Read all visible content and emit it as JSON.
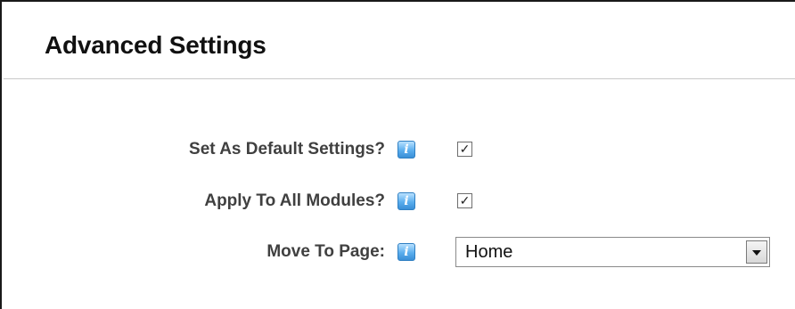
{
  "section": {
    "title": "Advanced Settings"
  },
  "settings": [
    {
      "label": "Set As Default Settings?",
      "help_icon": "help-icon",
      "checked": true,
      "check_mark": "✓"
    },
    {
      "label": "Apply To All Modules?",
      "help_icon": "help-icon",
      "checked": true,
      "check_mark": "✓"
    },
    {
      "label": "Move To Page:",
      "help_icon": "help-icon",
      "selected_value": "Home"
    }
  ],
  "colors": {
    "label_text": "#404040",
    "help_icon": "#3a8fd6",
    "divider": "#c9c9c9"
  }
}
